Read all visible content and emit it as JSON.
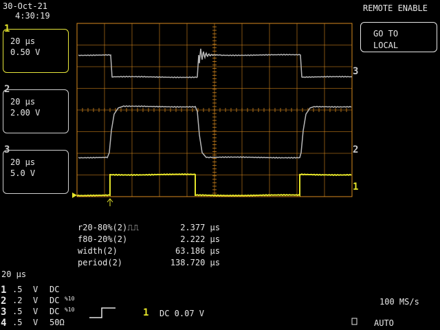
{
  "header": {
    "date": "30-Oct-21",
    "time": "4:30:19",
    "remote_label": "REMOTE ENABLE"
  },
  "menu": {
    "button_label_1": "GO TO",
    "button_label_2": "LOCAL"
  },
  "traces": [
    {
      "tag": "1",
      "timebase": "20 µs",
      "scale": "0.50 V",
      "selected": true
    },
    {
      "tag": "2",
      "timebase": "20 µs",
      "scale": "2.00 V",
      "selected": false
    },
    {
      "tag": "3",
      "timebase": "20 µs",
      "scale": "5.0 V",
      "selected": false
    }
  ],
  "right_markers": {
    "m3": "3",
    "m2": "2",
    "m1": "1"
  },
  "measurements": [
    {
      "label": "r20-80%(2)⎍⎍",
      "value": "2.377 µs"
    },
    {
      "label": "f80-20%(2)",
      "value": "2.222 µs"
    },
    {
      "label": "width(2)",
      "value": "63.186 µs"
    },
    {
      "label": "period(2)",
      "value": "138.720 µs"
    }
  ],
  "timebase": "20 µs",
  "channels": [
    {
      "num": "1",
      "volts": ".5",
      "unit": "V",
      "coupling": "DC",
      "extra": ""
    },
    {
      "num": "2",
      "volts": ".2",
      "unit": "V",
      "coupling": "DC",
      "extra": "%10"
    },
    {
      "num": "3",
      "volts": ".5",
      "unit": "V",
      "coupling": "DC",
      "extra": "%10"
    },
    {
      "num": "4",
      "volts": ".5",
      "unit": "V",
      "coupling": "50Ω",
      "extra": ""
    }
  ],
  "trigger": {
    "channel": "1",
    "text": "DC 0.07 V"
  },
  "sample_rate": "100 MS/s",
  "trigger_mode": "AUTO",
  "colors": {
    "grid": "#d98a1e",
    "trace_gray": "#b8b8b8",
    "trace_yellow": "#e6e62a",
    "text": "#e8e8e8"
  }
}
